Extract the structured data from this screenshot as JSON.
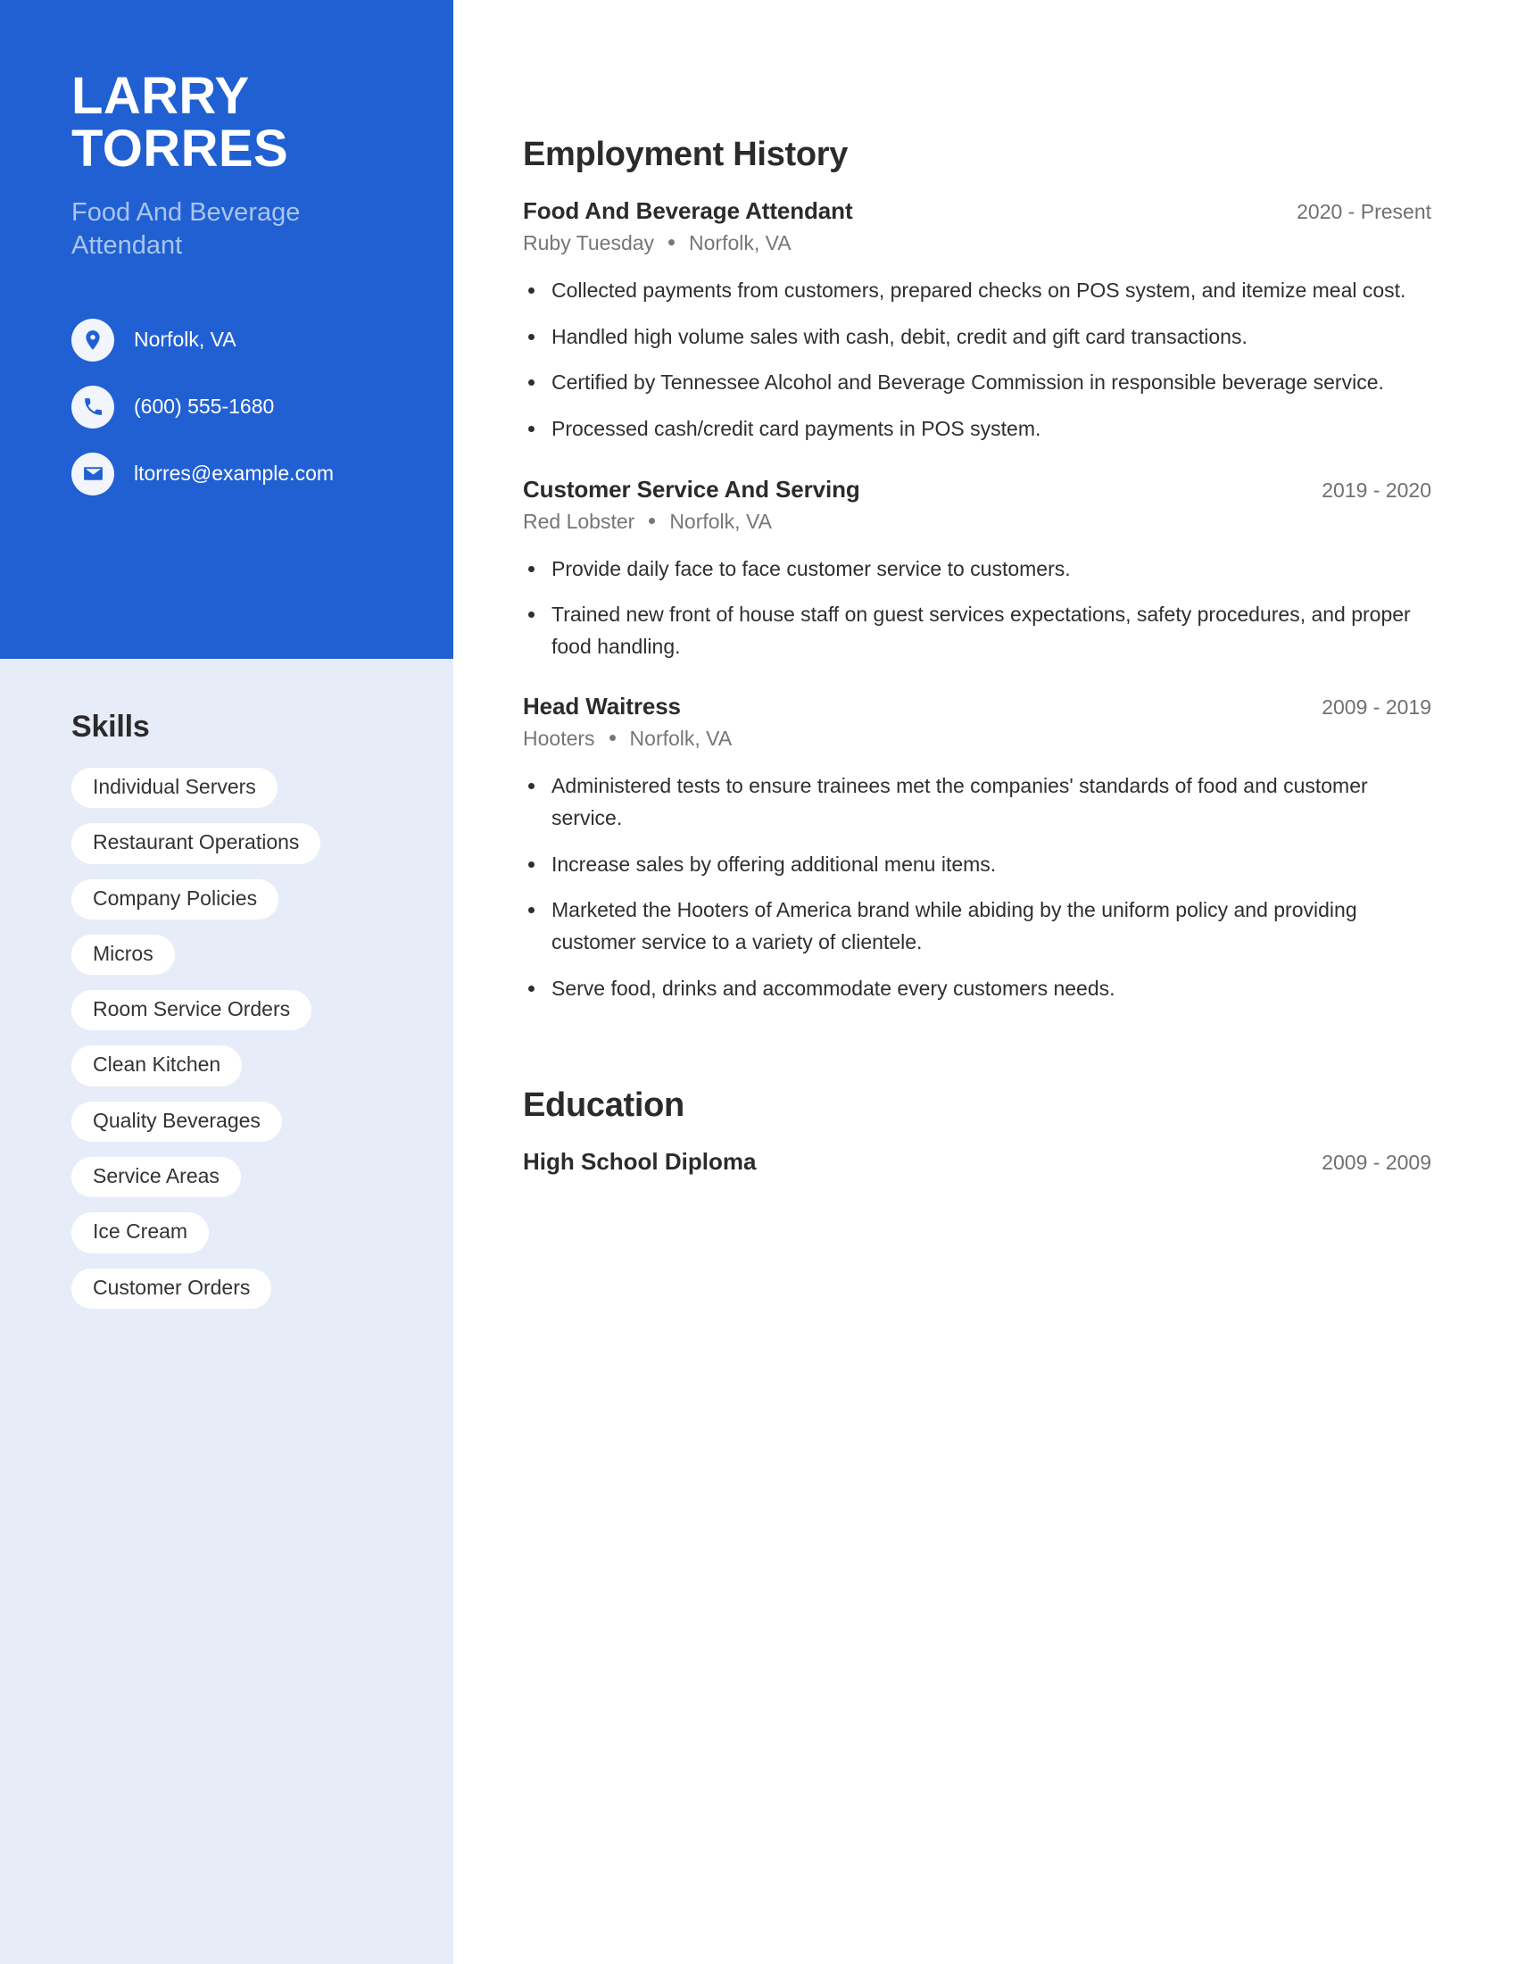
{
  "theme": {
    "accent": "#2160d3",
    "sidebar_bg": "#e6edf8",
    "subtitle": "#a9c5ee",
    "body_text": "#2f2f2f",
    "muted_text": "#767676"
  },
  "sidebar": {
    "name": "LARRY TORRES",
    "name_line1": "LARRY",
    "name_line2": "TORRES",
    "job_title": "Food And Beverage Attendant",
    "contacts": [
      {
        "icon": "location-pin-icon",
        "value": "Norfolk, VA"
      },
      {
        "icon": "phone-icon",
        "value": "(600) 555-1680"
      },
      {
        "icon": "envelope-icon",
        "value": "ltorres@example.com"
      }
    ],
    "skills_heading": "Skills",
    "skills": [
      "Individual Servers",
      "Restaurant Operations",
      "Company Policies",
      "Micros",
      "Room Service Orders",
      "Clean Kitchen",
      "Quality Beverages",
      "Service Areas",
      "Ice Cream",
      "Customer Orders"
    ]
  },
  "main": {
    "employment_heading": "Employment History",
    "jobs": [
      {
        "title": "Food And Beverage Attendant",
        "dates": "2020 - Present",
        "company": "Ruby Tuesday",
        "location": "Norfolk, VA",
        "bullets": [
          "Collected payments from customers, prepared checks on POS system, and itemize meal cost.",
          "Handled high volume sales with cash, debit, credit and gift card transactions.",
          "Certified by Tennessee Alcohol and Beverage Commission in responsible beverage service.",
          "Processed cash/credit card payments in POS system."
        ]
      },
      {
        "title": "Customer Service And Serving",
        "dates": "2019 - 2020",
        "company": "Red Lobster",
        "location": "Norfolk, VA",
        "bullets": [
          "Provide daily face to face customer service to customers.",
          "Trained new front of house staff on guest services expectations, safety procedures, and proper food handling."
        ]
      },
      {
        "title": "Head Waitress",
        "dates": "2009 - 2019",
        "company": "Hooters",
        "location": "Norfolk, VA",
        "bullets": [
          "Administered tests to ensure trainees met the companies' standards of food and customer service.",
          "Increase sales by offering additional menu items.",
          "Marketed the Hooters of America brand while abiding by the uniform policy and providing customer service to a variety of clientele.",
          "Serve food, drinks and accommodate every customers needs."
        ]
      }
    ],
    "education_heading": "Education",
    "education": [
      {
        "degree": "High School Diploma",
        "dates": "2009 - 2009"
      }
    ]
  }
}
